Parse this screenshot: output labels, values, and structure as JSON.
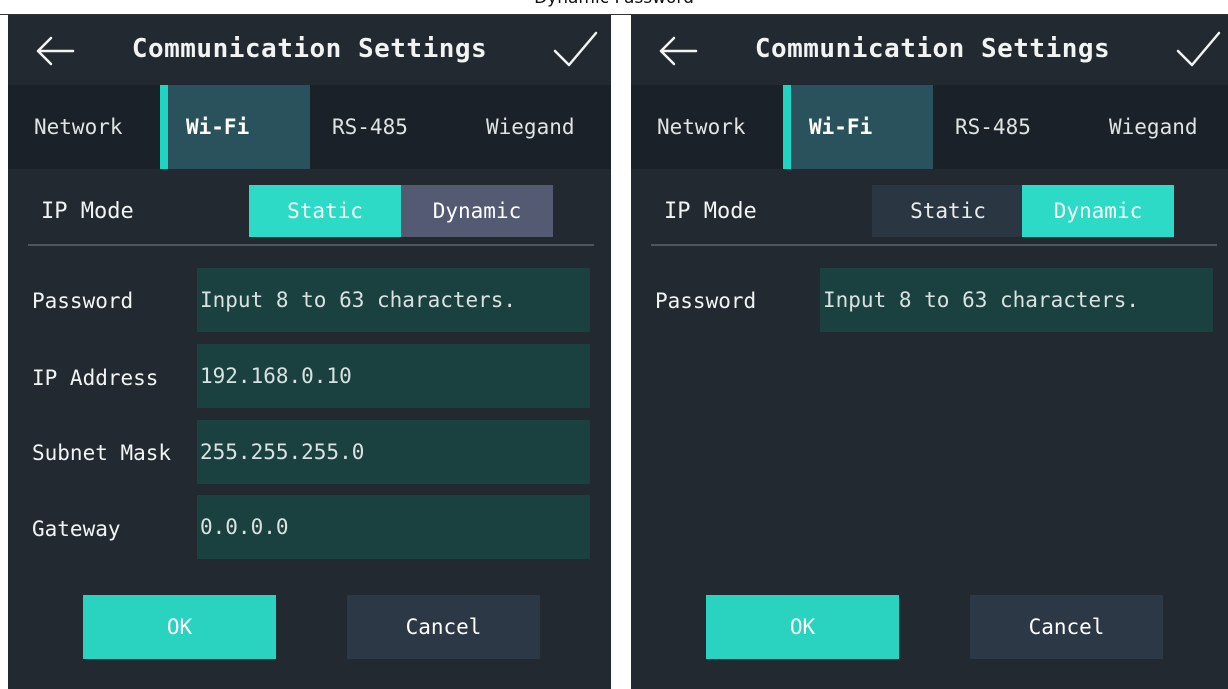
{
  "caption": "Dynamic Password",
  "screens": [
    {
      "title": "Communication Settings",
      "tabs": [
        "Network",
        "Wi-Fi",
        "RS-485",
        "Wiegand"
      ],
      "active_tab": "Wi-Fi",
      "ip_mode": {
        "label": "IP Mode",
        "options": [
          "Static",
          "Dynamic"
        ],
        "selected": "Static"
      },
      "fields": [
        {
          "label": "Password",
          "value": "Input 8 to 63 characters."
        },
        {
          "label": "IP Address",
          "value": "192.168.0.10"
        },
        {
          "label": "Subnet Mask",
          "value": "255.255.255.0"
        },
        {
          "label": "Gateway",
          "value": "0.0.0.0"
        }
      ],
      "ok_label": "OK",
      "cancel_label": "Cancel"
    },
    {
      "title": "Communication Settings",
      "tabs": [
        "Network",
        "Wi-Fi",
        "RS-485",
        "Wiegand"
      ],
      "active_tab": "Wi-Fi",
      "ip_mode": {
        "label": "IP Mode",
        "options": [
          "Static",
          "Dynamic"
        ],
        "selected": "Dynamic"
      },
      "fields": [
        {
          "label": "Password",
          "value": "Input 8 to 63 characters."
        }
      ],
      "ok_label": "OK",
      "cancel_label": "Cancel"
    }
  ],
  "colors": {
    "background": "#222931",
    "tab_bar": "#1b2129",
    "active_tab": "#2a525c",
    "accent": "#2ad3c0",
    "field": "#1a403f",
    "cancel_button": "#2c3845",
    "icons": [
      "back-arrow-icon",
      "checkmark-icon"
    ]
  }
}
